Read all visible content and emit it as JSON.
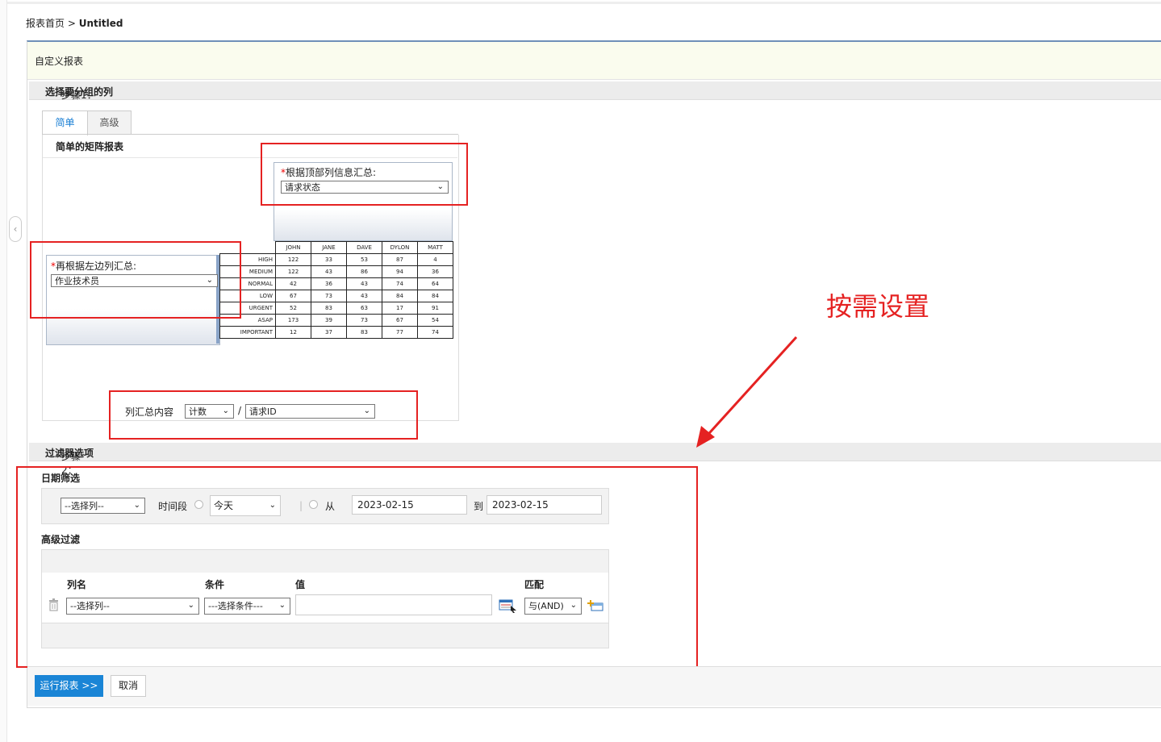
{
  "breadcrumb": {
    "home": "报表首页",
    "sep": ">",
    "current": "Untitled"
  },
  "title": "自定义报表",
  "step1": {
    "prefix": "步骤1：",
    "title": "选择要分组的列",
    "tabs": [
      "简单",
      "高级"
    ],
    "inner_title": "简单的矩阵报表",
    "top_group": {
      "required": "*",
      "label": "根据顶部列信息汇总:",
      "value": "请求状态"
    },
    "left_group": {
      "required": "*",
      "label": "再根据左边列汇总:",
      "value": "作业技术员"
    },
    "summary": {
      "label": "列汇总内容",
      "func": "计数",
      "slash": "/",
      "column": "请求ID"
    }
  },
  "matrix": {
    "columns": [
      "JOHN",
      "JANE",
      "DAVE",
      "DYLON",
      "MATT"
    ],
    "rows": [
      {
        "label": "HIGH",
        "values": [
          "122",
          "33",
          "53",
          "87",
          "4"
        ]
      },
      {
        "label": "MEDIUM",
        "values": [
          "122",
          "43",
          "86",
          "94",
          "36"
        ]
      },
      {
        "label": "NORMAL",
        "values": [
          "42",
          "36",
          "43",
          "74",
          "64"
        ]
      },
      {
        "label": "LOW",
        "values": [
          "67",
          "73",
          "43",
          "84",
          "84"
        ]
      },
      {
        "label": "URGENT",
        "values": [
          "52",
          "83",
          "63",
          "17",
          "91"
        ]
      },
      {
        "label": "ASAP",
        "values": [
          "173",
          "39",
          "73",
          "67",
          "54"
        ]
      },
      {
        "label": "IMPORTANT",
        "values": [
          "12",
          "37",
          "83",
          "77",
          "74"
        ]
      }
    ]
  },
  "step2": {
    "prefix": "步骤2：",
    "title": "过滤器选项",
    "date_filter": {
      "heading": "日期筛选",
      "column_select": "--选择列--",
      "period_label": "时间段",
      "period_value": "今天",
      "from_label": "从",
      "from_value": "2023-02-15",
      "to_label": "到",
      "to_value": "2023-02-15"
    },
    "advanced": {
      "heading": "高级过滤",
      "col_header": "列名",
      "cond_header": "条件",
      "value_header": "值",
      "match_header": "匹配",
      "column_select": "--选择列--",
      "condition_select": "---选择条件---",
      "value": "",
      "match_select": "与(AND)"
    }
  },
  "annotation": "按需设置",
  "buttons": {
    "run": "运行报表 >>",
    "cancel": "取消"
  },
  "colors": {
    "accent": "#1a85d6",
    "annotation_red": "#e52222",
    "tab_active": "#1a7fd4"
  }
}
